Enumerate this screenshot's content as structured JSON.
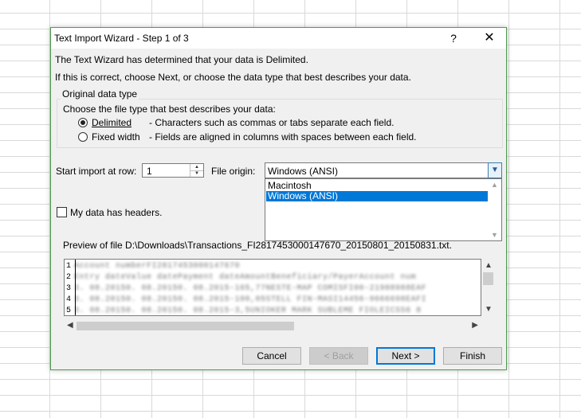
{
  "dialog": {
    "title": "Text Import Wizard - Step 1 of 3",
    "help_icon": "?",
    "close_icon": "✕",
    "intro_line1": "The Text Wizard has determined that your data is Delimited.",
    "intro_line2": "If this is correct, choose Next, or choose the data type that best describes your data."
  },
  "original_data_type": {
    "group_label": "Original data type",
    "prompt": "Choose the file type that best describes your data:",
    "options": [
      {
        "label": "Delimited",
        "description": "- Characters such as commas or tabs separate each field.",
        "checked": true
      },
      {
        "label": "Fixed width",
        "description": "- Fields are aligned in columns with spaces between each field.",
        "checked": false
      }
    ]
  },
  "start_row": {
    "label": "Start import at row:",
    "value": "1"
  },
  "file_origin": {
    "label": "File origin:",
    "selected": "Windows (ANSI)",
    "options": [
      "Macintosh",
      "Windows (ANSI)"
    ]
  },
  "headers_checkbox": {
    "label": "My data has headers.",
    "checked": false
  },
  "preview": {
    "label": "Preview of file D:\\Downloads\\Transactions_FI2817453000147670_20150801_20150831.txt.",
    "rows": [
      {
        "num": "1",
        "text": "Account numberFI2817453000147670"
      },
      {
        "num": "2",
        "text": "Entry dateValue datePayment dateAmountBeneficiary/PayerAccount num"
      },
      {
        "num": "3",
        "text": "3. 08.20150. 08.20150. 08.2015-165,77NESTE-MAP COMISFI00-21988988EAF"
      },
      {
        "num": "4",
        "text": "3. 08.20150. 08.20150. 08.2015-100,05STELL FIN-MASI14456-9666698EAFI"
      },
      {
        "num": "5",
        "text": "3. 08.20150. 08.20150. 08.2015-3,5UNIOKER MARK SUBLEME FIOLEICSS6 8"
      }
    ]
  },
  "buttons": {
    "cancel": "Cancel",
    "back": "< Back",
    "next": "Next >",
    "finish": "Finish"
  }
}
